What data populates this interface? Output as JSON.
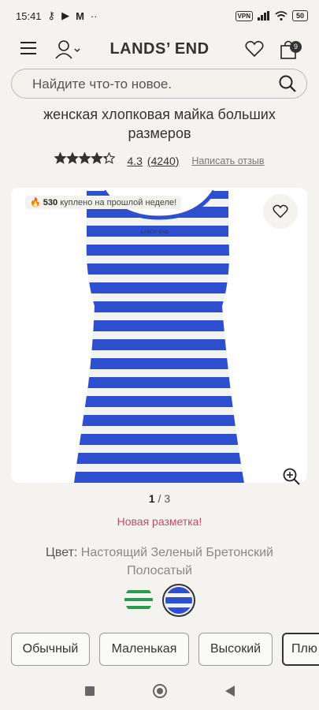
{
  "status": {
    "time": "15:41",
    "vpn": "VPN",
    "battery": "50"
  },
  "header": {
    "logo": "LANDS’ END",
    "bag_count": "9"
  },
  "search": {
    "placeholder": "Найдите что-то новое."
  },
  "product": {
    "title": "женская хлопковая майка больших размеров",
    "rating_value": "4.3",
    "rating_count": "(4240)",
    "rating_stars": 4.3,
    "write_review": "Написать отзыв",
    "badge_count": "530",
    "badge_text": "куплено на прошлой неделе!",
    "image_label": "LANDS' END"
  },
  "gallery": {
    "current": "1",
    "separator": "/",
    "total": "3"
  },
  "new_markdown": "Новая разметка!",
  "color": {
    "label": "Цвет:",
    "value": "Настоящий Зеленый Бретонский Полосатый"
  },
  "sizes": [
    {
      "label": "Обычный"
    },
    {
      "label": "Маленькая"
    },
    {
      "label": "Высокий"
    },
    {
      "label": "Плю"
    }
  ],
  "colors": {
    "stripe_blue": "#2f4fd1",
    "stripe_white": "#f0f3f0",
    "accent_pink": "#c04a6b"
  }
}
